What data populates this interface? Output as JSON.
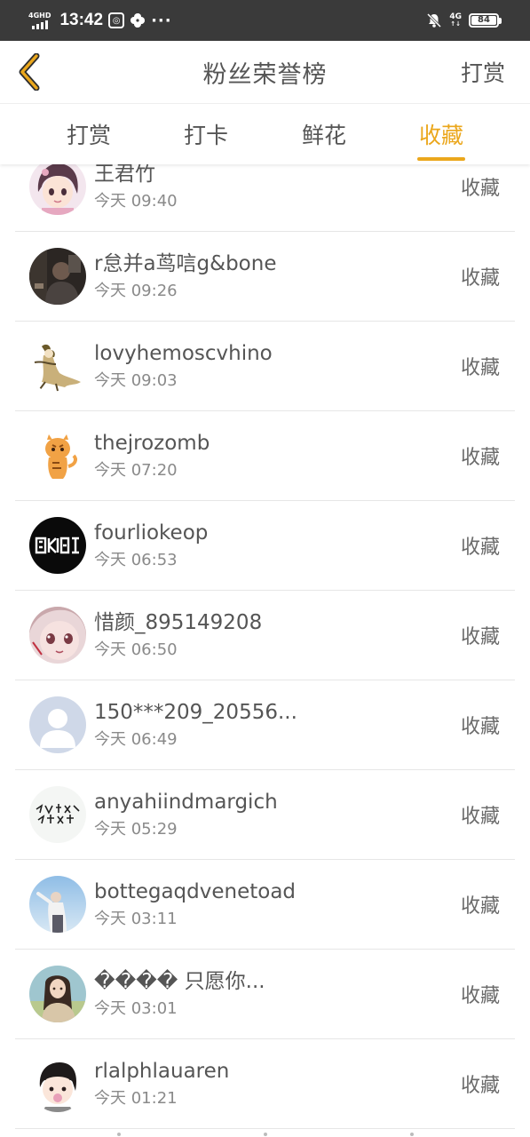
{
  "status_bar": {
    "network_label": "4GHD",
    "time": "13:42",
    "dots": "···",
    "right_network": "4G",
    "right_arrows": "↑↓",
    "battery": "84",
    "icons": [
      "signal-icon",
      "app-notification-icon",
      "pinwheel-icon",
      "mute-bell-icon",
      "battery-icon"
    ]
  },
  "header": {
    "title": "粉丝荣誉榜",
    "action_label": "打赏",
    "back_icon": "chevron-left-icon",
    "accent_color": "#eba71c"
  },
  "tabs": [
    {
      "label": "打赏",
      "active": false
    },
    {
      "label": "打卡",
      "active": false
    },
    {
      "label": "鲜花",
      "active": false
    },
    {
      "label": "收藏",
      "active": true
    }
  ],
  "list": {
    "items": [
      {
        "name": "王君竹",
        "time": "今天 09:40",
        "action": "收藏",
        "avatar": "cartoon-girl-avatar"
      },
      {
        "name": "r怠并a茑唁g&bone",
        "time": "今天 09:26",
        "action": "收藏",
        "avatar": "dark-photo-avatar"
      },
      {
        "name": "lovyhemoscvhino",
        "time": "今天 09:03",
        "action": "收藏",
        "avatar": "cartoon-figure-avatar"
      },
      {
        "name": "thejrozomb",
        "time": "今天 07:20",
        "action": "收藏",
        "avatar": "tiger-cartoon-avatar"
      },
      {
        "name": "fourliokeop",
        "time": "今天 06:53",
        "action": "收藏",
        "avatar": "black-text-logo-avatar"
      },
      {
        "name": "惜颜_895149208",
        "time": "今天 06:50",
        "action": "收藏",
        "avatar": "anime-girl-avatar"
      },
      {
        "name": "150***209_20556...",
        "time": "今天 06:49",
        "action": "收藏",
        "avatar": "default-user-avatar"
      },
      {
        "name": "anyahiindmargich",
        "time": "今天 05:29",
        "action": "收藏",
        "avatar": "handwriting-avatar"
      },
      {
        "name": "bottegaqdvenetoad",
        "time": "今天 03:11",
        "action": "收藏",
        "avatar": "sky-photo-avatar"
      },
      {
        "name": "���� 只愿你...",
        "time": "今天 03:01",
        "action": "收藏",
        "avatar": "girl-photo-avatar"
      },
      {
        "name": "rlalphlauaren",
        "time": "今天 01:21",
        "action": "收藏",
        "avatar": "cartoon-boy-avatar"
      }
    ]
  }
}
